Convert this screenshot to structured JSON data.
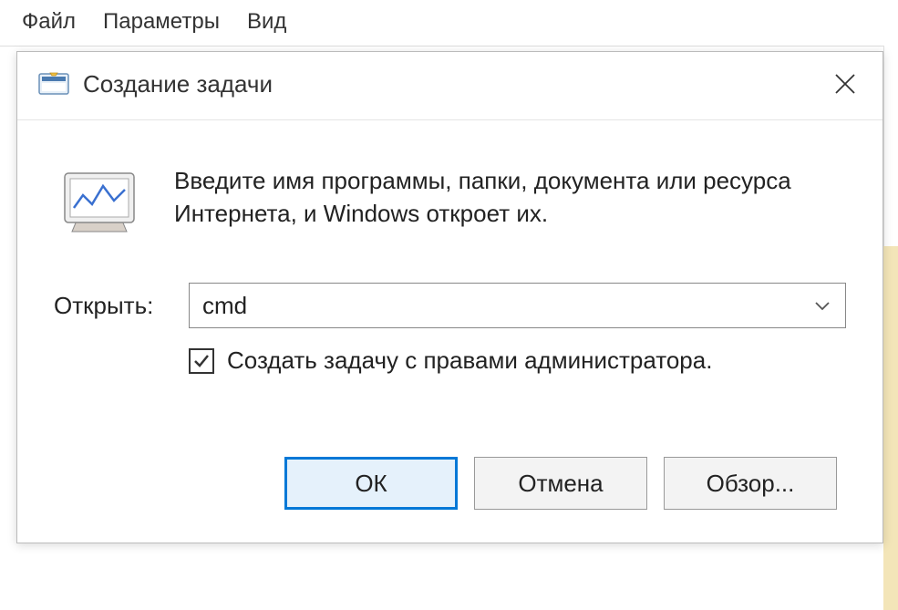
{
  "menubar": {
    "file": "Файл",
    "options": "Параметры",
    "view": "Вид"
  },
  "dialog": {
    "title": "Создание задачи",
    "info_text": "Введите имя программы, папки, документа или ресурса Интернета, и Windows откроет их.",
    "open_label": "Открыть:",
    "open_value": "cmd",
    "admin_checkbox_label": "Создать задачу с правами администратора.",
    "admin_checked": true
  },
  "buttons": {
    "ok": "ОК",
    "cancel": "Отмена",
    "browse": "Обзор..."
  }
}
